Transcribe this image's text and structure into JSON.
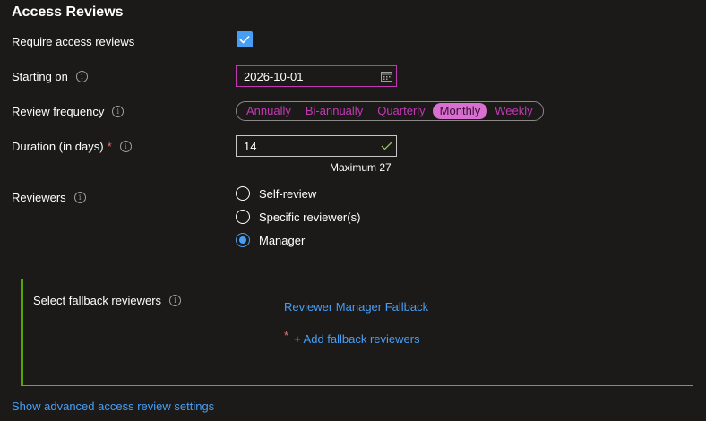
{
  "section": {
    "title": "Access Reviews"
  },
  "require_reviews": {
    "label": "Require access reviews",
    "checked": true
  },
  "starting_on": {
    "label": "Starting on",
    "value": "2026-10-01"
  },
  "review_frequency": {
    "label": "Review frequency",
    "options": [
      "Annually",
      "Bi-annually",
      "Quarterly",
      "Monthly",
      "Weekly"
    ],
    "selected": "Monthly"
  },
  "duration": {
    "label": "Duration (in days)",
    "required_mark": "*",
    "value": "14",
    "hint": "Maximum 27"
  },
  "reviewers": {
    "label": "Reviewers",
    "options": [
      "Self-review",
      "Specific reviewer(s)",
      "Manager"
    ],
    "selected": "Manager"
  },
  "fallback": {
    "label": "Select fallback reviewers",
    "manager_fallback_link": "Reviewer Manager Fallback",
    "required_mark": "*",
    "add_link": "+ Add fallback reviewers"
  },
  "advanced_link": "Show advanced access review settings",
  "colors": {
    "accent": "#479ef5",
    "pill_accent": "#c239b3",
    "pill_selected_bg": "#d86fd1",
    "fallback_border": "#57a300",
    "valid_check": "#92c353"
  }
}
